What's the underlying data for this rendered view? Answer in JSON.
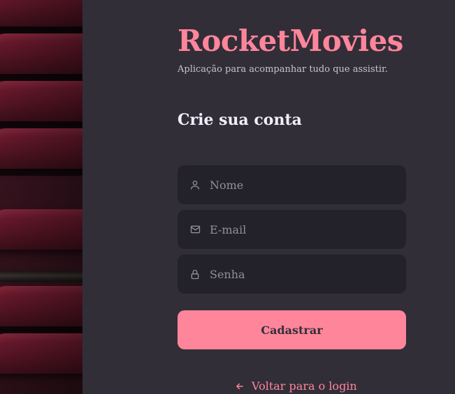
{
  "brand": {
    "title": "RocketMovies",
    "tagline": "Aplicação para acompanhar tudo que assistir."
  },
  "form": {
    "heading": "Crie sua conta",
    "fields": [
      {
        "icon": "user-icon",
        "placeholder": "Nome",
        "value": ""
      },
      {
        "icon": "mail-icon",
        "placeholder": "E-mail",
        "value": ""
      },
      {
        "icon": "lock-icon",
        "placeholder": "Senha",
        "value": ""
      }
    ],
    "submit_label": "Cadastrar"
  },
  "footer": {
    "back_icon": "arrow-left-icon",
    "back_label": "Voltar para o login"
  },
  "colors": {
    "accent": "#ff859b",
    "background": "#312e38",
    "input_background": "#232129",
    "placeholder": "#948f99",
    "heading": "#f4edff"
  }
}
